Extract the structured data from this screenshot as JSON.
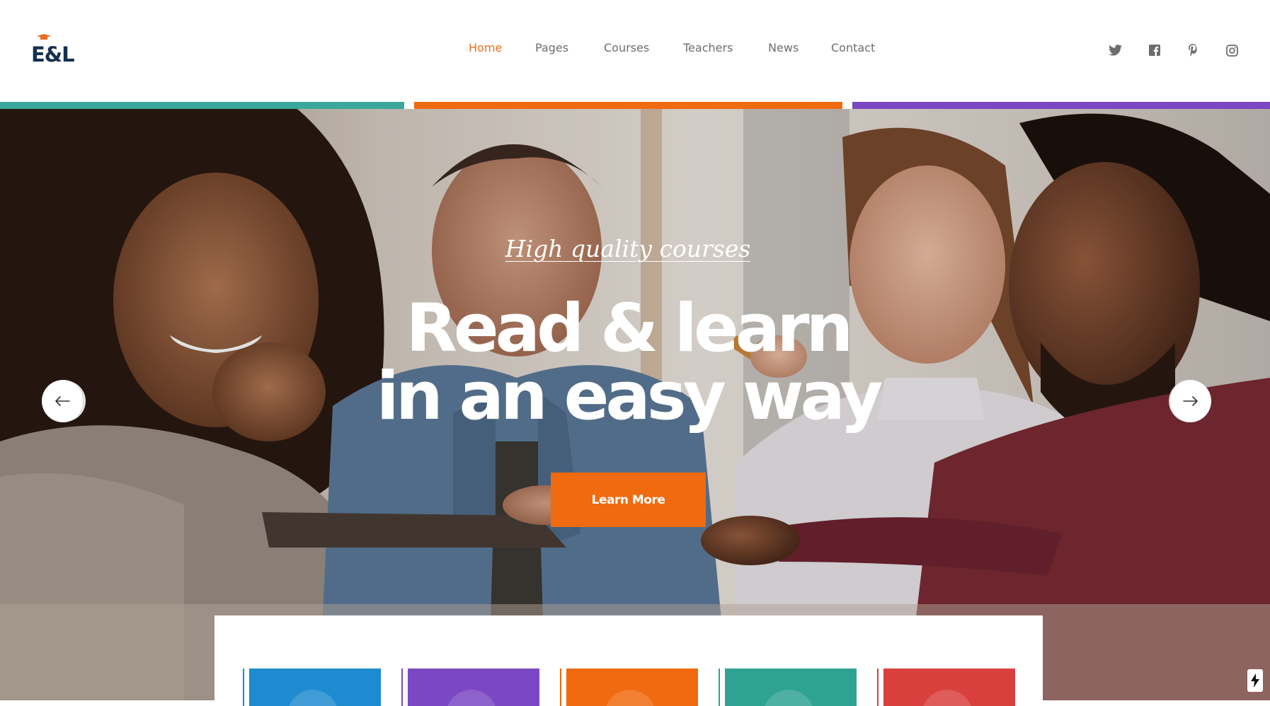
{
  "header": {
    "logo_text": "E&L",
    "nav": {
      "home": "Home",
      "pages": "Pages",
      "courses": "Courses",
      "teachers": "Teachers",
      "news": "News",
      "contact": "Contact"
    },
    "social_icons": [
      "twitter-icon",
      "facebook-icon",
      "pinterest-icon",
      "instagram-icon"
    ]
  },
  "colors": {
    "accent_orange": "#f06a0f",
    "nav_active": "#e86e1c",
    "bar_teal": "#3aa79c",
    "bar_orange": "#f06a0f",
    "bar_purple": "#7b47c2",
    "logo_navy": "#14304e",
    "card_blue": "#1e8bd1",
    "card_purple": "#7b47c2",
    "card_orange": "#f06a0f",
    "card_teal": "#2ea393",
    "card_red": "#d9403d"
  },
  "hero": {
    "tagline": "High quality courses",
    "headline_line1": "Read & learn",
    "headline_line2": "in an easy way",
    "cta_label": "Learn More",
    "prev_icon": "arrow-left-icon",
    "next_icon": "arrow-right-icon"
  },
  "feature_cards": [
    "blue",
    "purple",
    "orange",
    "teal",
    "red"
  ]
}
